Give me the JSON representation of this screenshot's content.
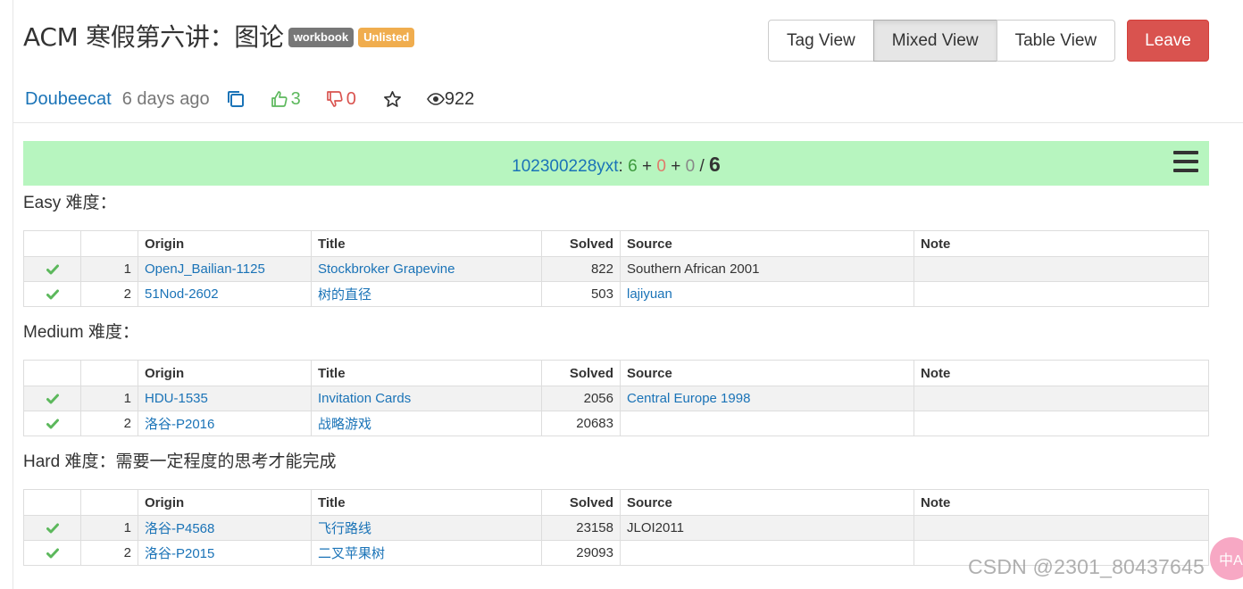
{
  "header": {
    "title": "ACM 寒假第六讲：图论",
    "badges": [
      "workbook",
      "Unlisted"
    ],
    "views": [
      "Tag View",
      "Mixed View",
      "Table View"
    ],
    "active_view": "Mixed View",
    "leave_label": "Leave"
  },
  "meta": {
    "author": "Doubeecat",
    "time": "6 days ago",
    "upvotes": "3",
    "downvotes": "0",
    "views": "922"
  },
  "status": {
    "user": "102300228yxt",
    "colon": ":",
    "accepted": "6",
    "failed": "0",
    "other": "0",
    "total": "6"
  },
  "columns": [
    "Origin",
    "Title",
    "Solved",
    "Source",
    "Note"
  ],
  "sections": [
    {
      "title": "Easy 难度：",
      "rows": [
        {
          "index": "1",
          "origin": "OpenJ_Bailian-1125",
          "title": "Stockbroker Grapevine",
          "solved": "822",
          "source": "Southern African 2001",
          "source_is_link": false,
          "note": ""
        },
        {
          "index": "2",
          "origin": "51Nod-2602",
          "title": "树的直径",
          "solved": "503",
          "source": "lajiyuan",
          "source_is_link": true,
          "note": ""
        }
      ]
    },
    {
      "title": "Medium 难度：",
      "rows": [
        {
          "index": "1",
          "origin": "HDU-1535",
          "title": "Invitation Cards",
          "solved": "2056",
          "source": "Central Europe 1998",
          "source_is_link": true,
          "note": ""
        },
        {
          "index": "2",
          "origin": "洛谷-P2016",
          "title": "战略游戏",
          "solved": "20683",
          "source": "",
          "source_is_link": false,
          "note": ""
        }
      ]
    },
    {
      "title": "Hard 难度：需要一定程度的思考才能完成",
      "rows": [
        {
          "index": "1",
          "origin": "洛谷-P4568",
          "title": "飞行路线",
          "solved": "23158",
          "source": "JLOI2011",
          "source_is_link": false,
          "note": ""
        },
        {
          "index": "2",
          "origin": "洛谷-P2015",
          "title": "二叉苹果树",
          "solved": "29093",
          "source": "",
          "source_is_link": false,
          "note": ""
        }
      ]
    }
  ],
  "watermark": "CSDN @2301_80437645",
  "bubble_text": "中A",
  "colors": {
    "link": "#1a73b7",
    "success": "#5cb85c",
    "danger": "#d9534f",
    "status_bg": "#b7f5bf",
    "badge_gray": "#777777",
    "badge_orange": "#f0ad4e"
  }
}
